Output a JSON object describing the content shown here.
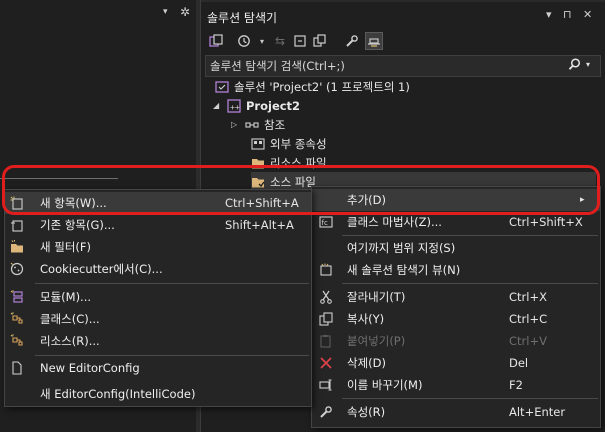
{
  "left_panel": {
    "dropdown_glyph": "▾",
    "gear_glyph": "✲"
  },
  "solution_explorer": {
    "title": "솔루션 탐색기",
    "title_controls": [
      "▾",
      "⊓",
      "✕"
    ],
    "search_placeholder": "솔루션 탐색기 검색(Ctrl+;)",
    "tree": {
      "solution": "솔루션 'Project2' (1 프로젝트의 1)",
      "project": "Project2",
      "references": "참조",
      "external": "외부 종속성",
      "resources": "리소스 파일",
      "source": "소스 파일"
    }
  },
  "context_menu": {
    "items": [
      {
        "label": "추가(D)",
        "shortcut": "",
        "icon": "none",
        "disabled": false
      },
      {
        "label": "클래스 마법사(Z)...",
        "shortcut": "Ctrl+Shift+X",
        "icon": "class-wizard-icon",
        "disabled": false
      },
      {
        "label": "여기까지 범위 지정(S)",
        "shortcut": "",
        "icon": "none",
        "disabled": false
      },
      {
        "label": "새 솔루션 탐색기 뷰(N)",
        "shortcut": "",
        "icon": "new-view-icon",
        "disabled": false
      },
      {
        "label": "잘라내기(T)",
        "shortcut": "Ctrl+X",
        "icon": "cut-icon",
        "disabled": false
      },
      {
        "label": "복사(Y)",
        "shortcut": "Ctrl+C",
        "icon": "copy-icon",
        "disabled": false
      },
      {
        "label": "붙여넣기(P)",
        "shortcut": "Ctrl+V",
        "icon": "paste-icon",
        "disabled": true
      },
      {
        "label": "삭제(D)",
        "shortcut": "Del",
        "icon": "delete-icon",
        "disabled": false
      },
      {
        "label": "이름 바꾸기(M)",
        "shortcut": "F2",
        "icon": "rename-icon",
        "disabled": false
      },
      {
        "label": "속성(R)",
        "shortcut": "Alt+Enter",
        "icon": "properties-icon",
        "disabled": false
      }
    ],
    "submenu_arrow": "▸"
  },
  "add_submenu": {
    "items": [
      {
        "label": "새 항목(W)...",
        "shortcut": "Ctrl+Shift+A"
      },
      {
        "label": "기존 항목(G)...",
        "shortcut": "Shift+Alt+A"
      },
      {
        "label": "새 필터(F)",
        "shortcut": ""
      },
      {
        "label": "Cookiecutter에서(C)...",
        "shortcut": ""
      },
      {
        "label": "모듈(M)...",
        "shortcut": ""
      },
      {
        "label": "클래스(C)...",
        "shortcut": ""
      },
      {
        "label": "리소스(R)...",
        "shortcut": ""
      },
      {
        "label": "New EditorConfig",
        "shortcut": ""
      },
      {
        "label": "새 EditorConfig(IntelliCode)",
        "shortcut": ""
      }
    ]
  },
  "colors": {
    "accent": "#e01e1e",
    "vs_purple": "#b180d7",
    "folder": "#dcb67a",
    "delete_red": "#e0434b",
    "hover": "#3a3a3a"
  }
}
